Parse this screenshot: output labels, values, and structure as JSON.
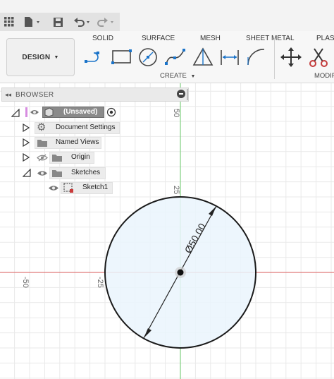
{
  "toolbar": {
    "workspace_label": "DESIGN",
    "tabs": [
      "SOLID",
      "SURFACE",
      "MESH",
      "SHEET METAL",
      "PLAS"
    ],
    "create_label": "CREATE",
    "modify_label": "MODIF"
  },
  "browser": {
    "title": "BROWSER",
    "root_label": "(Unsaved)",
    "items": [
      {
        "label": "Document Settings"
      },
      {
        "label": "Named Views"
      },
      {
        "label": "Origin"
      },
      {
        "label": "Sketches"
      },
      {
        "label": "Sketch1"
      }
    ]
  },
  "canvas": {
    "axis_labels": [
      "50",
      "25",
      "-50",
      "-25"
    ],
    "dimension_label": "Ø50.00"
  },
  "icons": [
    "grid-menu-icon",
    "file-icon",
    "save-icon",
    "undo-icon",
    "redo-icon",
    "line-icon",
    "rectangle-icon",
    "circle-icon",
    "spline-icon",
    "triangle-icon",
    "dimension-icon",
    "arc-icon",
    "move-icon",
    "scissors-icon",
    "eye-icon",
    "gear-icon",
    "folder-icon",
    "sketch-icon"
  ],
  "colors": {
    "x_axis": "#e07a7a",
    "y_axis": "#7fcf7f",
    "profile_fill": "#eaf4fd",
    "tool_blue": "#1b74c9",
    "grid": "#e9e9e9"
  }
}
